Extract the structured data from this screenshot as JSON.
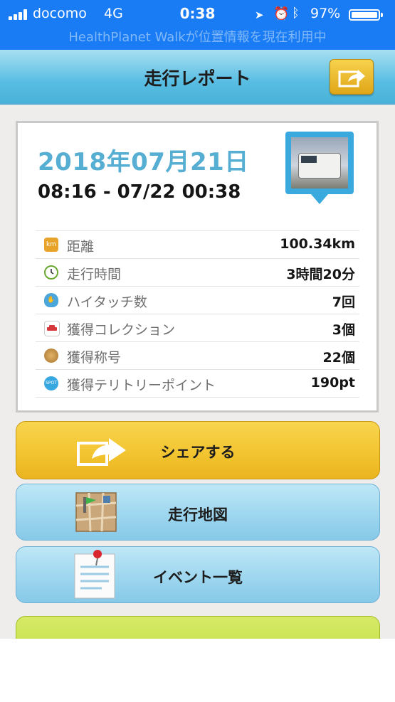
{
  "status_bar": {
    "carrier": "docomo",
    "network": "4G",
    "time": "0:38",
    "battery_percent": "97%",
    "location_banner": "HealthPlanet Walkが位置情報を現在利用中",
    "icons": [
      "signal-icon",
      "location-arrow-icon",
      "alarm-icon",
      "bluetooth-icon",
      "battery-icon"
    ]
  },
  "header": {
    "title": "走行レポート",
    "share_icon": "share-arrow-icon"
  },
  "report": {
    "date": "2018年07月21日",
    "time_range": "08:16 - 07/22 00:38",
    "photo_icon": "vehicle-photo-pin"
  },
  "stats": [
    {
      "icon": "km-icon",
      "label": "距離",
      "value": "100.34km"
    },
    {
      "icon": "clock-icon",
      "label": "走行時間",
      "value": "3時間20分"
    },
    {
      "icon": "hand-icon",
      "label": "ハイタッチ数",
      "value": "7回"
    },
    {
      "icon": "car-collection-icon",
      "label": "獲得コレクション",
      "value": "3個"
    },
    {
      "icon": "medal-icon",
      "label": "獲得称号",
      "value": "22個"
    },
    {
      "icon": "spot-icon",
      "label": "獲得テリトリーポイント",
      "value": "190pt"
    }
  ],
  "stat_icon_text": {
    "km": "km",
    "spot": "SPOT"
  },
  "buttons": {
    "share": "シェアする",
    "map": "走行地図",
    "events": "イベント一覧"
  },
  "colors": {
    "status_bar": "#1a7cf4",
    "header": "#58bde2",
    "date_text": "#56aed2",
    "share_button": "#f2c32e",
    "map_button": "#9bd5ee",
    "top_button": "#c3df44"
  }
}
